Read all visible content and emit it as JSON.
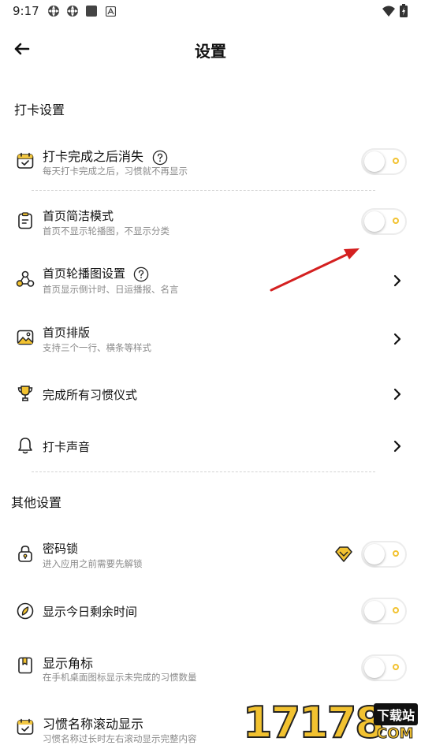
{
  "status_bar": {
    "time": "9:17"
  },
  "header": {
    "title": "设置"
  },
  "sections": {
    "checkin": "打卡设置",
    "other": "其他设置"
  },
  "rows": {
    "disappear": {
      "label": "打卡完成之后消失",
      "sub": "每天打卡完成之后，习惯就不再显示",
      "toggle_on": false
    },
    "simple_mode": {
      "label": "首页简洁模式",
      "sub": "首页不显示轮播图，不显示分类",
      "toggle_on": false
    },
    "carousel": {
      "label": "首页轮播图设置",
      "sub": "首页显示倒计时、日运播报、名言"
    },
    "layout": {
      "label": "首页排版",
      "sub": "支持三个一行、横条等样式"
    },
    "ritual": {
      "label": "完成所有习惯仪式"
    },
    "sound": {
      "label": "打卡声音"
    },
    "lock": {
      "label": "密码锁",
      "sub": "进入应用之前需要先解锁",
      "toggle_on": false
    },
    "remaining": {
      "label": "显示今日剩余时间",
      "toggle_on": false
    },
    "badge": {
      "label": "显示角标",
      "sub": "在手机桌面图标显示未完成的习惯数量",
      "toggle_on": false
    },
    "scroll_name": {
      "label": "习惯名称滚动显示",
      "sub": "习惯名称过长时左右滚动显示完整内容"
    }
  },
  "watermark": {
    "number": "17178",
    "site": "下载站",
    "domain": "COM"
  },
  "colors": {
    "accent": "#f2c230",
    "arrow": "#d42020",
    "subtext": "#8a8a8a"
  }
}
